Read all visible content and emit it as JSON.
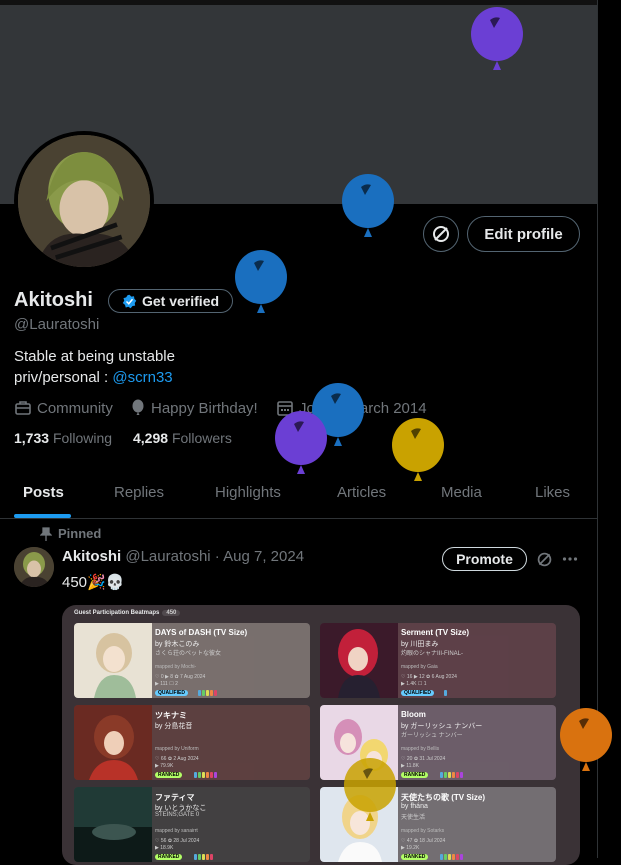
{
  "profile": {
    "name": "Akitoshi",
    "handle": "@Lauratoshi",
    "verify_label": "Get verified",
    "edit_label": "Edit profile",
    "bio_line1": "Stable at being unstable",
    "bio_line2_prefix": "priv/personal : ",
    "bio_line2_link": "@scrn33",
    "category": "Community",
    "birthday": "Happy Birthday!",
    "joined": "Joined March 2014",
    "following_count": "1,733",
    "following_label": "Following",
    "followers_count": "4,298",
    "followers_label": "Followers"
  },
  "tabs": [
    "Posts",
    "Replies",
    "Highlights",
    "Articles",
    "Media",
    "Likes"
  ],
  "post": {
    "pinned_label": "Pinned",
    "author": "Akitoshi",
    "meta": "@Lauratoshi · Aug 7, 2024",
    "promote_label": "Promote",
    "text": "450🎉💀",
    "card": {
      "title": "Guest Participation Beatmaps",
      "count": "450",
      "maps": [
        {
          "title": "DAYS of DASH (TV Size)",
          "artist": "by 鈴木このみ",
          "source": "さくら荘のペットな彼女",
          "mapper": "mapped by Mochi-",
          "stats1": "♡ 0   ▶ 8   ✿ 7 Aug 2024",
          "stats2": "▶ 111   ☐ 2",
          "status": "QUALIFIED"
        },
        {
          "title": "Serment (TV Size)",
          "artist": "by 川田まみ",
          "source": "灼眼のシャナIII-FINAL-",
          "mapper": "mapped by Gaia",
          "stats1": "♡ 16   ▶ 12   ✿ 6 Aug 2024",
          "stats2": "▶ 1.4K   ☐ 1",
          "status": "QUALIFIED"
        },
        {
          "title": "ツキナミ",
          "artist": "by 分島花音",
          "source": "",
          "mapper": "mapped by Uniform",
          "stats1": "♡ 66   ✿ 2 Aug 2024",
          "stats2": "▶ 79.9K",
          "status": "RANKED"
        },
        {
          "title": "Bloom",
          "artist": "by ガーリッシュ ナンバー",
          "source": "ガーリッシュ ナンバー",
          "mapper": "mapped by Bellis",
          "stats1": "♡ 20   ✿ 31 Jul 2024",
          "stats2": "▶ 11.8K",
          "status": "RANKED"
        },
        {
          "title": "ファティマ",
          "artist": "by いとうかなこ",
          "source": "STEINS;GATE 0",
          "mapper": "mapped by sanairrt",
          "stats1": "♡ 56   ✿ 28 Jul 2024",
          "stats2": "▶ 18.9K",
          "status": "RANKED"
        },
        {
          "title": "天使たちの歌 (TV Size)",
          "artist": "by fhána",
          "source": "天使生活",
          "mapper": "mapped by Sotarks",
          "stats1": "♡ 47   ✿ 18 Jul 2024",
          "stats2": "▶ 19.2K",
          "status": "RANKED"
        }
      ]
    }
  },
  "colors": {
    "accent": "#1d9bf0",
    "qualified": "#66ccff",
    "ranked": "#b3ff66",
    "balloon_purple": "#6b3fd4",
    "balloon_blue": "#1a6fbf",
    "balloon_gold": "#c9a200",
    "balloon_orange": "#d9720f"
  }
}
